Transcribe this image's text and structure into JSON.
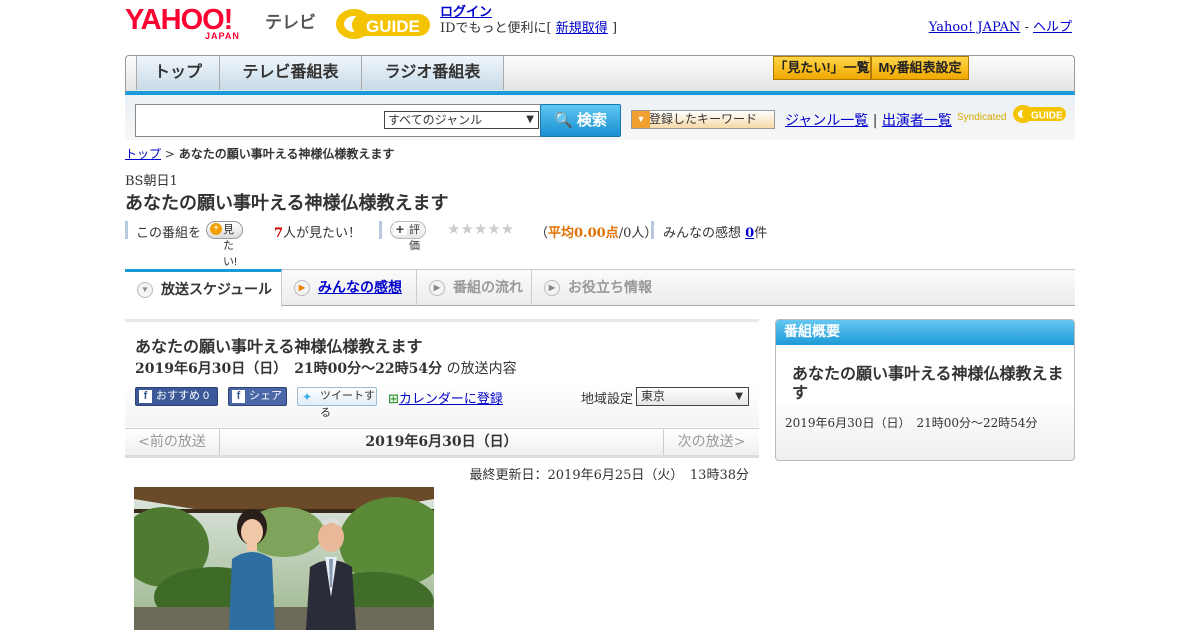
{
  "header": {
    "logo_text": "YAHOO!",
    "logo_sub": "JAPAN",
    "tv_label": "テレビ",
    "gguide_logo": "GUIDE",
    "login_link": "ログイン",
    "login_prefix": "IDでもっと便利に[",
    "register_link": "新規取得",
    "login_suffix": "]",
    "yahoo_japan_link": "Yahoo! JAPAN",
    "help_sep": " - ",
    "help_link": "ヘルプ"
  },
  "nav": {
    "tabs": [
      {
        "label": "トップ"
      },
      {
        "label": "テレビ番組表"
      },
      {
        "label": "ラジオ番組表"
      }
    ],
    "mitai_list": "「見たい!」一覧",
    "my_guide": "My番組表設定"
  },
  "search": {
    "genre_select": "すべてのジャンル",
    "button": "検索",
    "keyword_button": "登録したキーワード",
    "genre_list_link": "ジャンル一覧",
    "divider": "|",
    "performer_link": "出演者一覧",
    "syndicated": "Syndicated"
  },
  "breadcrumb": {
    "top": "トップ",
    "sep": " > ",
    "current": "あなたの願い事叶える神様仏様教えます"
  },
  "station": "BS朝日1",
  "title": "あなたの願い事叶える神様仏様教えます",
  "rating": {
    "prefix": "この番組を",
    "mitai_button": "見たい!",
    "mitai_count": "7",
    "mitai_suffix": "人が見たい！",
    "hyouka_button": "評価",
    "stars": "★★★★★",
    "avg_open": "（",
    "avg_label": "平均0.00点",
    "avg_count": "/0人）",
    "kansou_label": "みんなの感想",
    "kansou_count": "0",
    "kansou_suffix": "件"
  },
  "section_tabs": {
    "schedule": "放送スケジュール",
    "kansou": "みんなの感想",
    "flow": "番組の流れ",
    "info": "お役立ち情報"
  },
  "program": {
    "title": "あなたの願い事叶える神様仏様教えます",
    "time": "2019年6月30日（日）　21時00分～22時54分",
    "time_suffix": " の放送内容",
    "fb_recommend": "おすすめ 0",
    "fb_share": "シェア",
    "tweet": "ツイートする",
    "calendar": "カレンダーに登録",
    "region_label": "地域設定",
    "region_value": "東京"
  },
  "date_nav": {
    "prev": "<前の放送",
    "date": "2019年6月30日（日）",
    "next": "次の放送>"
  },
  "updated": "最終更新日：2019年6月25日（火）　13時38分",
  "side": {
    "header": "番組概要",
    "title": "あなたの願い事叶える神様仏様教えます",
    "time": "2019年6月30日（日）　21時00分～22時54分"
  },
  "colors": {
    "accent_blue": "#1a9ad6",
    "yahoo_red": "#ff0033",
    "link_blue": "#0000cc",
    "gold": "#f0a800"
  }
}
